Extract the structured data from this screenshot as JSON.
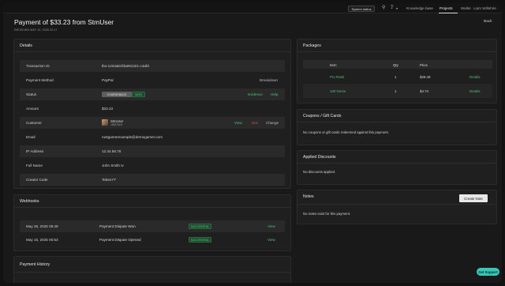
{
  "nav": {
    "status_label": "System status",
    "links": [
      "Knowledge base",
      "Projects",
      "Wallet",
      "Liam Wiltshire"
    ]
  },
  "header": {
    "title": "Payment of $33.23 from StmUser",
    "subtitle": "RECEIVED MAY 13, 2025 22:17",
    "back_label": "Back"
  },
  "details": {
    "title": "Details",
    "rows": [
      {
        "label": "Transaction ID",
        "value": "tbx-1234abcfda091321-c4afd"
      },
      {
        "label": "Payment Method",
        "value": "PayPal",
        "action": "Breakdown"
      },
      {
        "label": "Status",
        "badge1": "CHARGEBACK",
        "badge2": "WON",
        "action1": "Evidence",
        "action2": "Help"
      },
      {
        "label": "Amount",
        "value": "$33.23"
      },
      {
        "label": "Customer",
        "name": "StmUser",
        "id": "16857613I",
        "action1": "View",
        "action2": "Ban",
        "action3": "Change"
      },
      {
        "label": "Email",
        "value": "rustgamerexample@demogamer.com"
      },
      {
        "label": "IP Address",
        "value": "12.34.56.78"
      },
      {
        "label": "Full Name",
        "value": "John Smith Iv"
      },
      {
        "label": "Creator Code",
        "value": "TebexYT"
      }
    ]
  },
  "webhooks": {
    "title": "Webhooks",
    "rows": [
      {
        "date": "May 26, 2025 09:49",
        "event": "Payment Dispute Won",
        "status": "SUCCESSFUL",
        "action": "View"
      },
      {
        "date": "May 15, 2025 06:53",
        "event": "Payment Dispute Opened",
        "status": "SUCCESSFUL",
        "action": "View"
      }
    ]
  },
  "history": {
    "title": "Payment History"
  },
  "packages": {
    "title": "Packages",
    "headers": [
      "Item",
      "Qty",
      "Price"
    ],
    "rows": [
      {
        "item": "Pro Rank",
        "qty": "1",
        "price": "$28.49",
        "action": "Details"
      },
      {
        "item": "100 Gems",
        "qty": "1",
        "price": "$4.74",
        "action": "Details"
      }
    ]
  },
  "coupons": {
    "title": "Coupons / Gift Cards",
    "empty": "No coupons or gift cards redeemed against this payment."
  },
  "discounts": {
    "title": "Applied Discounts",
    "empty": "No discounts applied."
  },
  "notes": {
    "title": "Notes",
    "create_label": "Create Note",
    "empty": "No notes exist for this payment."
  },
  "support_label": "Get Support",
  "colors": {
    "accent_green": "#4cc178",
    "danger_red": "#d04848",
    "support_teal": "#37c9b5"
  }
}
